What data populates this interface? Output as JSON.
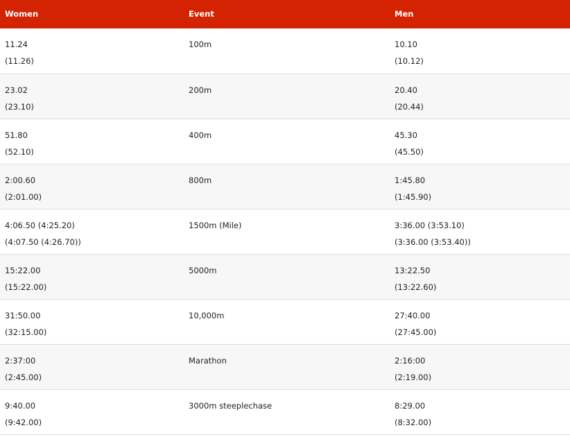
{
  "header": {
    "women": "Women",
    "event": "Event",
    "men": "Men"
  },
  "rows": [
    {
      "women": "11.24",
      "women_alt": "(11.26)",
      "event": "100m",
      "men": "10.10",
      "men_alt": "(10.12)"
    },
    {
      "women": "23.02",
      "women_alt": "(23.10)",
      "event": "200m",
      "men": "20.40",
      "men_alt": "(20.44)"
    },
    {
      "women": "51.80",
      "women_alt": "(52.10)",
      "event": "400m",
      "men": "45.30",
      "men_alt": "(45.50)"
    },
    {
      "women": "2:00.60",
      "women_alt": "(2:01.00)",
      "event": "800m",
      "men": "1:45.80",
      "men_alt": "(1:45.90)"
    },
    {
      "women": "4:06.50 (4:25.20)",
      "women_alt": "(4:07.50 (4:26.70))",
      "event": "1500m (Mile)",
      "men": "3:36.00 (3:53.10)",
      "men_alt": "(3:36.00 (3:53.40))"
    },
    {
      "women": "15:22.00",
      "women_alt": "(15:22.00)",
      "event": "5000m",
      "men": "13:22.50",
      "men_alt": "(13:22.60)"
    },
    {
      "women": "31:50.00",
      "women_alt": "(32:15.00)",
      "event": "10,000m",
      "men": "27:40.00",
      "men_alt": "(27:45.00)"
    },
    {
      "women": "2:37:00",
      "women_alt": "(2:45.00)",
      "event": "Marathon",
      "men": "2:16:00",
      "men_alt": "(2:19.00)"
    },
    {
      "women": "9:40.00",
      "women_alt": "(9:42.00)",
      "event": "3000m steeplechase",
      "men": "8:29.00",
      "men_alt": "(8:32.00)"
    }
  ],
  "colors": {
    "header_bg": "#d42302",
    "header_text": "#ffffff",
    "row_alt_bg": "#f7f7f7",
    "divider": "#dddddd"
  }
}
